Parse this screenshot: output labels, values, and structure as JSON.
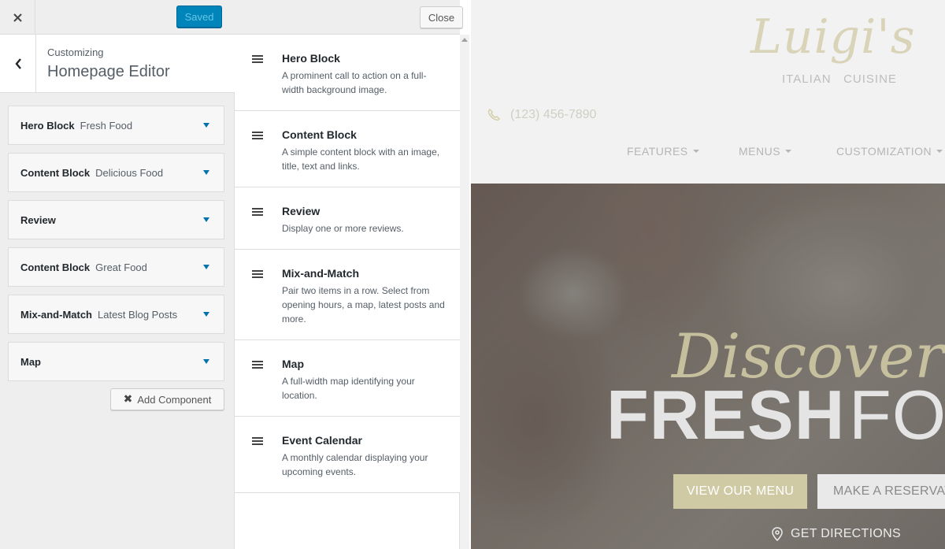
{
  "topbar": {
    "close_icon": "close-icon",
    "saved_label": "Saved"
  },
  "section": {
    "eyebrow": "Customizing",
    "title": "Homepage Editor"
  },
  "components": [
    {
      "type": "Hero Block",
      "name": "Fresh Food"
    },
    {
      "type": "Content Block",
      "name": "Delicious Food"
    },
    {
      "type": "Review",
      "name": ""
    },
    {
      "type": "Content Block",
      "name": "Great Food"
    },
    {
      "type": "Mix-and-Match",
      "name": "Latest Blog Posts"
    },
    {
      "type": "Map",
      "name": ""
    }
  ],
  "add_component_label": "Add Component",
  "library": {
    "close_label": "Close",
    "items": [
      {
        "title": "Hero Block",
        "desc": "A prominent call to action on a full-width background image."
      },
      {
        "title": "Content Block",
        "desc": "A simple content block with an image, title, text and links."
      },
      {
        "title": "Review",
        "desc": "Display one or more reviews."
      },
      {
        "title": "Mix-and-Match",
        "desc": "Pair two items in a row. Select from opening hours, a map, latest posts and more."
      },
      {
        "title": "Map",
        "desc": "A full-width map identifying your location."
      },
      {
        "title": "Event Calendar",
        "desc": "A monthly calendar displaying your upcoming events."
      }
    ]
  },
  "preview": {
    "logo_script": "Luigi's",
    "logo_sub": "ITALIAN   CUISINE",
    "phone": "(123) 456-7890",
    "nav": [
      "FEATURES",
      "MENUS",
      "CUSTOMIZATION"
    ],
    "hero": {
      "script": "Discover O",
      "bold": "FRESH",
      "light": "FO",
      "btn_menu": "VIEW OUR MENU",
      "btn_reserve": "MAKE A RESERVATI",
      "directions": "GET DIRECTIONS"
    }
  },
  "colors": {
    "accent": "#0085ba",
    "arrow": "#0073aa",
    "brand_gold": "#cfc9a4"
  }
}
